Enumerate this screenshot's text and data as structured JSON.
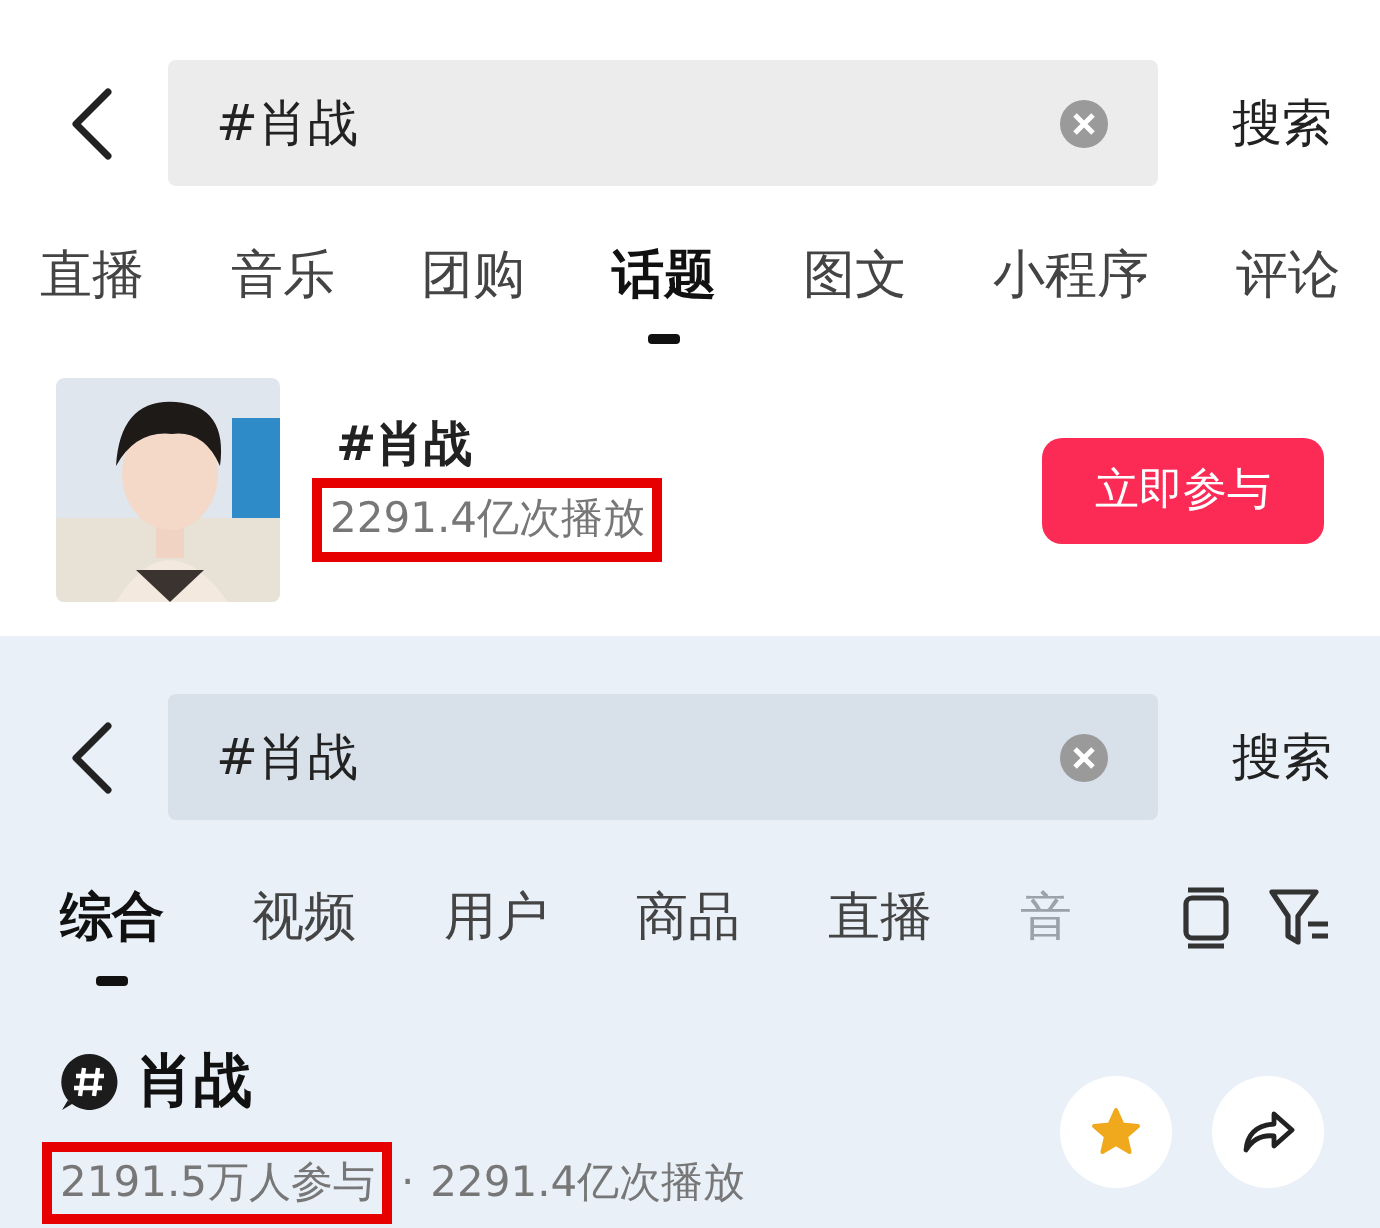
{
  "top_screen": {
    "search": {
      "value": "#肖战",
      "clear": true,
      "button": "搜索"
    },
    "tabs": [
      {
        "label": "直播",
        "selected": false
      },
      {
        "label": "音乐",
        "selected": false
      },
      {
        "label": "团购",
        "selected": false
      },
      {
        "label": "话题",
        "selected": true
      },
      {
        "label": "图文",
        "selected": false
      },
      {
        "label": "小程序",
        "selected": false
      },
      {
        "label": "评论",
        "selected": false
      }
    ],
    "topic": {
      "kind": "picture",
      "title": "#肖战",
      "plays": "2291.4亿次播放",
      "plays_highlighted": true,
      "join_button": "立即参与"
    }
  },
  "bottom_screen": {
    "search": {
      "value": "#肖战",
      "clear": true,
      "button": "搜索"
    },
    "tabs": [
      {
        "label": "综合",
        "selected": true
      },
      {
        "label": "视频",
        "selected": false
      },
      {
        "label": "用户",
        "selected": false
      },
      {
        "label": "商品",
        "selected": false
      },
      {
        "label": "直播",
        "selected": false
      },
      {
        "label": "音",
        "selected": false,
        "faded": true
      }
    ],
    "topic": {
      "title": "肖战",
      "participants": "2191.5万人参与",
      "participants_highlighted": true,
      "separator": "·",
      "plays": "2291.4亿次播放",
      "favorited": true
    }
  }
}
